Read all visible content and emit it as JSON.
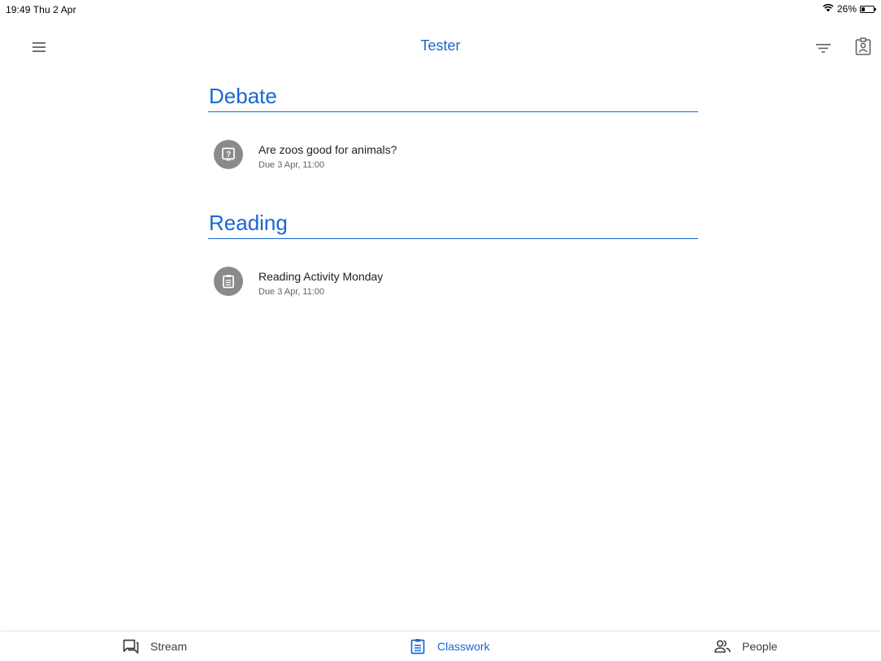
{
  "status_bar": {
    "time_date": "19:49  Thu 2 Apr",
    "battery_text": "26%",
    "battery_level": 0.26
  },
  "app_bar": {
    "title": "Tester",
    "icons": {
      "menu": "menu-icon",
      "filter": "filter-icon",
      "profile": "profile-icon"
    }
  },
  "topics": [
    {
      "title": "Debate",
      "items": [
        {
          "title": "Are zoos good for animals?",
          "due": "Due 3 Apr, 11:00",
          "icon": "question-icon"
        }
      ]
    },
    {
      "title": "Reading",
      "items": [
        {
          "title": "Reading Activity Monday",
          "due": "Due 3 Apr, 11:00",
          "icon": "assignment-icon"
        }
      ]
    }
  ],
  "bottom_nav": {
    "tabs": [
      {
        "label": "Stream",
        "icon": "stream-icon",
        "active": false
      },
      {
        "label": "Classwork",
        "icon": "classwork-icon",
        "active": true
      },
      {
        "label": "People",
        "icon": "people-icon",
        "active": false
      }
    ]
  },
  "colors": {
    "accent": "#1967d2",
    "item_icon_bg": "#8a8a8a",
    "text_primary": "#202124",
    "text_secondary": "#5f6368"
  }
}
